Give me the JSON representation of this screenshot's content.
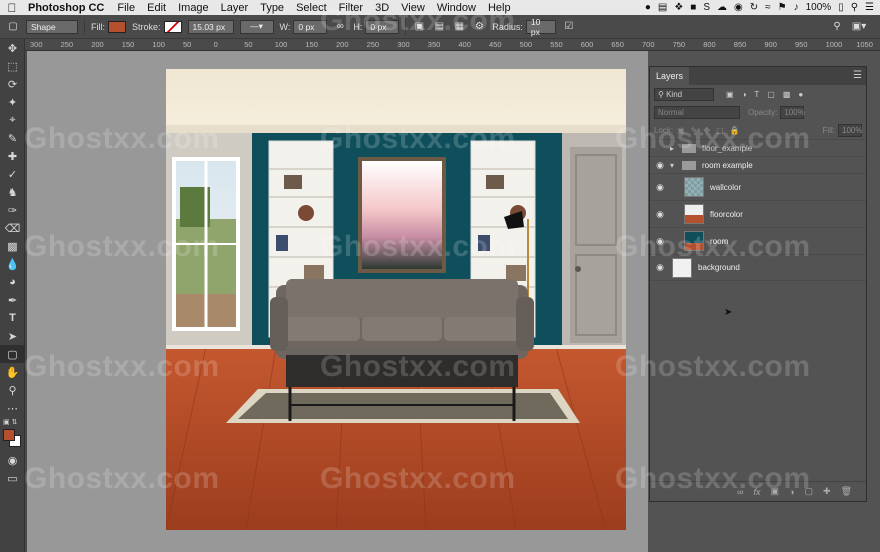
{
  "menubar": {
    "app_name": "Photoshop CC",
    "items": [
      "File",
      "Edit",
      "Image",
      "Layer",
      "Type",
      "Select",
      "Filter",
      "3D",
      "View",
      "Window",
      "Help"
    ],
    "battery": "100%"
  },
  "options": {
    "tool_mode": "Shape",
    "fill_label": "Fill:",
    "fill_color": "#b5502e",
    "stroke_label": "Stroke:",
    "stroke_width": "15.03 px",
    "w_label": "W:",
    "w_value": "0 px",
    "h_label": "H:",
    "h_value": "0 px",
    "radius_label": "Radius:",
    "radius_value": "10 px"
  },
  "ruler": {
    "ticks": [
      "300",
      "250",
      "200",
      "150",
      "100",
      "50",
      "0",
      "50",
      "100",
      "150",
      "200",
      "250",
      "300",
      "350",
      "400",
      "450",
      "500",
      "550",
      "600",
      "650",
      "700",
      "750",
      "800",
      "850",
      "900",
      "950",
      "1000",
      "1050"
    ]
  },
  "layers_panel": {
    "tab": "Layers",
    "filter_kind": "Kind",
    "blend_mode": "Normal",
    "opacity_label": "Opacity:",
    "opacity_value": "100%",
    "lock_label": "Lock:",
    "fill_label": "Fill:",
    "fill_value": "100%",
    "layers": [
      {
        "name": "floor_example",
        "kind": "group",
        "expanded": false,
        "visible": false
      },
      {
        "name": "room example",
        "kind": "group",
        "expanded": true,
        "visible": true
      },
      {
        "name": "wallcolor",
        "kind": "layer",
        "visible": true
      },
      {
        "name": "floorcolor",
        "kind": "layer",
        "visible": true
      },
      {
        "name": "room",
        "kind": "layer",
        "visible": true
      },
      {
        "name": "background",
        "kind": "layer",
        "visible": true
      }
    ]
  },
  "watermarks": [
    "Ghostxx.com",
    "Ghostxx.com",
    "Ghostxx.com",
    "Ghostxx.com",
    "Ghostxx.com",
    "Ghostxx.com",
    "Ghostxx.com",
    "Ghostxx.com",
    "Ghostxx.com",
    "Ghostxx.com",
    "Ghostxx.com",
    "Ghostxx.com",
    "Ghostxx.com"
  ],
  "colors": {
    "wall": "#0f4f5c",
    "floor": "#b5502e",
    "foreground_swatch": "#b5502e",
    "background_swatch": "#ffffff"
  }
}
